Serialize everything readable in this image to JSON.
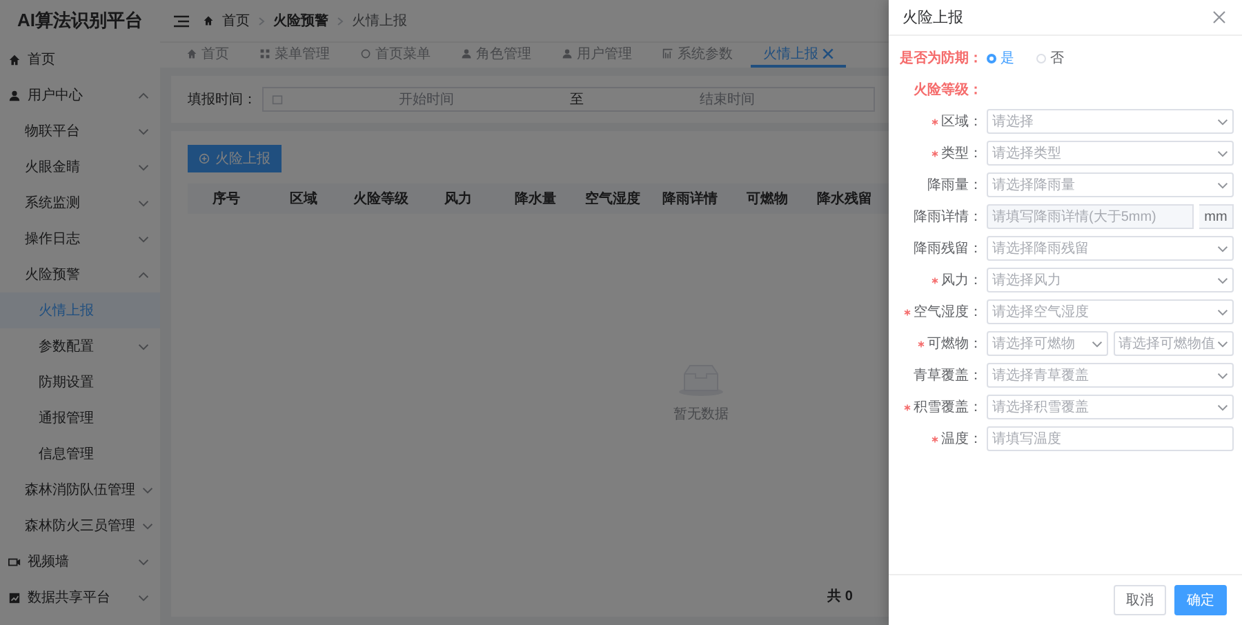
{
  "app_title": "AI算法识别平台",
  "breadcrumb": [
    "首页",
    "火险预警",
    "火情上报"
  ],
  "sidebar": {
    "items": [
      {
        "label": "首页",
        "selected": false
      },
      {
        "label": "用户中心",
        "selected": false,
        "expanded": true,
        "children": [
          {
            "label": "物联平台",
            "selected": false,
            "expanded": false
          },
          {
            "label": "火眼金睛",
            "selected": false,
            "expanded": false
          },
          {
            "label": "系统监测",
            "selected": false,
            "expanded": false
          },
          {
            "label": "操作日志",
            "selected": false,
            "expanded": false
          },
          {
            "label": "火险预警",
            "selected": false,
            "expanded": true,
            "children": [
              {
                "label": "火情上报",
                "selected": true
              },
              {
                "label": "参数配置",
                "selected": false,
                "expanded": false
              },
              {
                "label": "防期设置",
                "selected": false
              },
              {
                "label": "通报管理",
                "selected": false
              },
              {
                "label": "信息管理",
                "selected": false
              }
            ]
          },
          {
            "label": "森林消防队伍管理",
            "selected": false,
            "expanded": false
          },
          {
            "label": "森林防火三员管理",
            "selected": false,
            "expanded": false
          }
        ]
      },
      {
        "label": "视频墙",
        "selected": false,
        "expanded": false
      },
      {
        "label": "数据共享平台",
        "selected": false,
        "expanded": false
      }
    ]
  },
  "tabs": [
    {
      "label": "首页",
      "selected": false,
      "closable": false
    },
    {
      "label": "菜单管理",
      "selected": false,
      "closable": false
    },
    {
      "label": "首页菜单",
      "selected": false,
      "closable": false
    },
    {
      "label": "角色管理",
      "selected": false,
      "closable": false
    },
    {
      "label": "用户管理",
      "selected": false,
      "closable": false
    },
    {
      "label": "系统参数",
      "selected": false,
      "closable": false
    },
    {
      "label": "火情上报",
      "selected": true,
      "closable": true
    }
  ],
  "filter": {
    "label": "填报时间：",
    "start_placeholder": "开始时间",
    "separator": "至",
    "end_placeholder": "结束时间"
  },
  "add_button": "火险上报",
  "table": {
    "columns": [
      "序号",
      "区域",
      "火险等级",
      "风力",
      "降水量",
      "空气湿度",
      "降雨详情",
      "可燃物",
      "降水残留"
    ],
    "empty_text": "暂无数据"
  },
  "pagination": {
    "total": "共 0"
  },
  "drawer": {
    "title": "火险上报",
    "rows": [
      {
        "kind": "radio",
        "label": "是否为防期：",
        "options": [
          {
            "label": "是",
            "selected": true
          },
          {
            "label": "否",
            "selected": false
          }
        ]
      },
      {
        "kind": "heading",
        "label": "火险等级："
      },
      {
        "kind": "select",
        "label": "区域：",
        "required": true,
        "placeholder": "请选择"
      },
      {
        "kind": "select",
        "label": "类型：",
        "required": true,
        "placeholder": "请选择类型"
      },
      {
        "kind": "select",
        "label": "降雨量：",
        "required": false,
        "placeholder": "请选择降雨量"
      },
      {
        "kind": "unit",
        "label": "降雨详情：",
        "required": false,
        "placeholder": "请填写降雨详情(大于5mm)",
        "unit": "mm"
      },
      {
        "kind": "select",
        "label": "降雨残留：",
        "required": false,
        "placeholder": "请选择降雨残留"
      },
      {
        "kind": "select",
        "label": "风力：",
        "required": true,
        "placeholder": "请选择风力"
      },
      {
        "kind": "select",
        "label": "空气湿度：",
        "required": true,
        "placeholder": "请选择空气湿度"
      },
      {
        "kind": "pair",
        "label": "可燃物：",
        "required": true,
        "placeholders": [
          "请选择可燃物",
          "请选择可燃物值"
        ]
      },
      {
        "kind": "select",
        "label": "青草覆盖：",
        "required": false,
        "placeholder": "请选择青草覆盖"
      },
      {
        "kind": "select",
        "label": "积雪覆盖：",
        "required": true,
        "placeholder": "请选择积雪覆盖"
      },
      {
        "kind": "input",
        "label": "温度：",
        "required": true,
        "placeholder": "请填写温度"
      }
    ],
    "cancel": "取消",
    "confirm": "确定"
  }
}
